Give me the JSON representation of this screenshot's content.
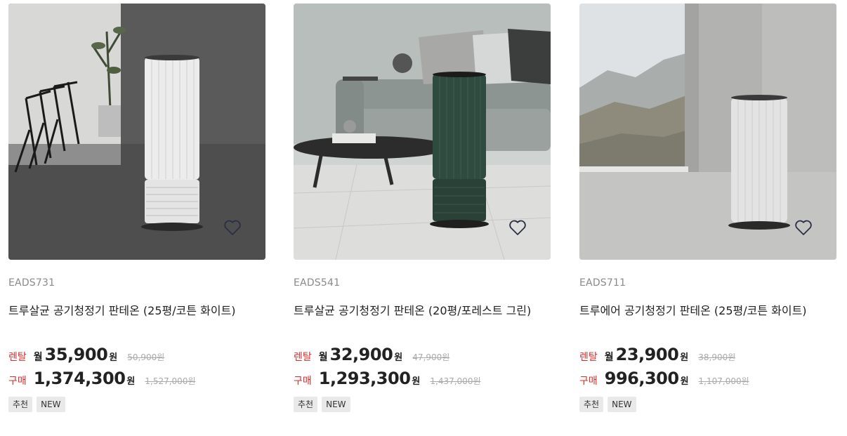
{
  "products": [
    {
      "code": "EADS731",
      "name": "트루살균 공기청정기 판테온 (25평/코튼 화이트)",
      "rent_label": "렌탈",
      "monthly_label": "월",
      "rent_price": "35,900",
      "rent_unit": "원",
      "rent_original": "50,900원",
      "buy_label": "구매",
      "buy_price": "1,374,300",
      "buy_unit": "원",
      "buy_original": "1,527,000원",
      "tags": [
        "추천",
        "NEW"
      ],
      "heart_icon": "heart-outline-icon"
    },
    {
      "code": "EADS541",
      "name": "트루살균 공기청정기 판테온 (20평/포레스트 그린)",
      "rent_label": "렌탈",
      "monthly_label": "월",
      "rent_price": "32,900",
      "rent_unit": "원",
      "rent_original": "47,900원",
      "buy_label": "구매",
      "buy_price": "1,293,300",
      "buy_unit": "원",
      "buy_original": "1,437,000원",
      "tags": [
        "추천",
        "NEW"
      ],
      "heart_icon": "heart-outline-icon"
    },
    {
      "code": "EADS711",
      "name": "트루에어 공기청정기 판테온 (25평/코튼 화이트)",
      "rent_label": "렌탈",
      "monthly_label": "월",
      "rent_price": "23,900",
      "rent_unit": "원",
      "rent_original": "38,900원",
      "buy_label": "구매",
      "buy_price": "996,300",
      "buy_unit": "원",
      "buy_original": "1,107,000원",
      "tags": [
        "추천",
        "NEW"
      ],
      "heart_icon": "heart-outline-icon"
    }
  ],
  "colors": {
    "label_red": "#d92c2c",
    "tag_bg": "#e9e9e9",
    "original_price_gray": "#aaaaaa"
  }
}
